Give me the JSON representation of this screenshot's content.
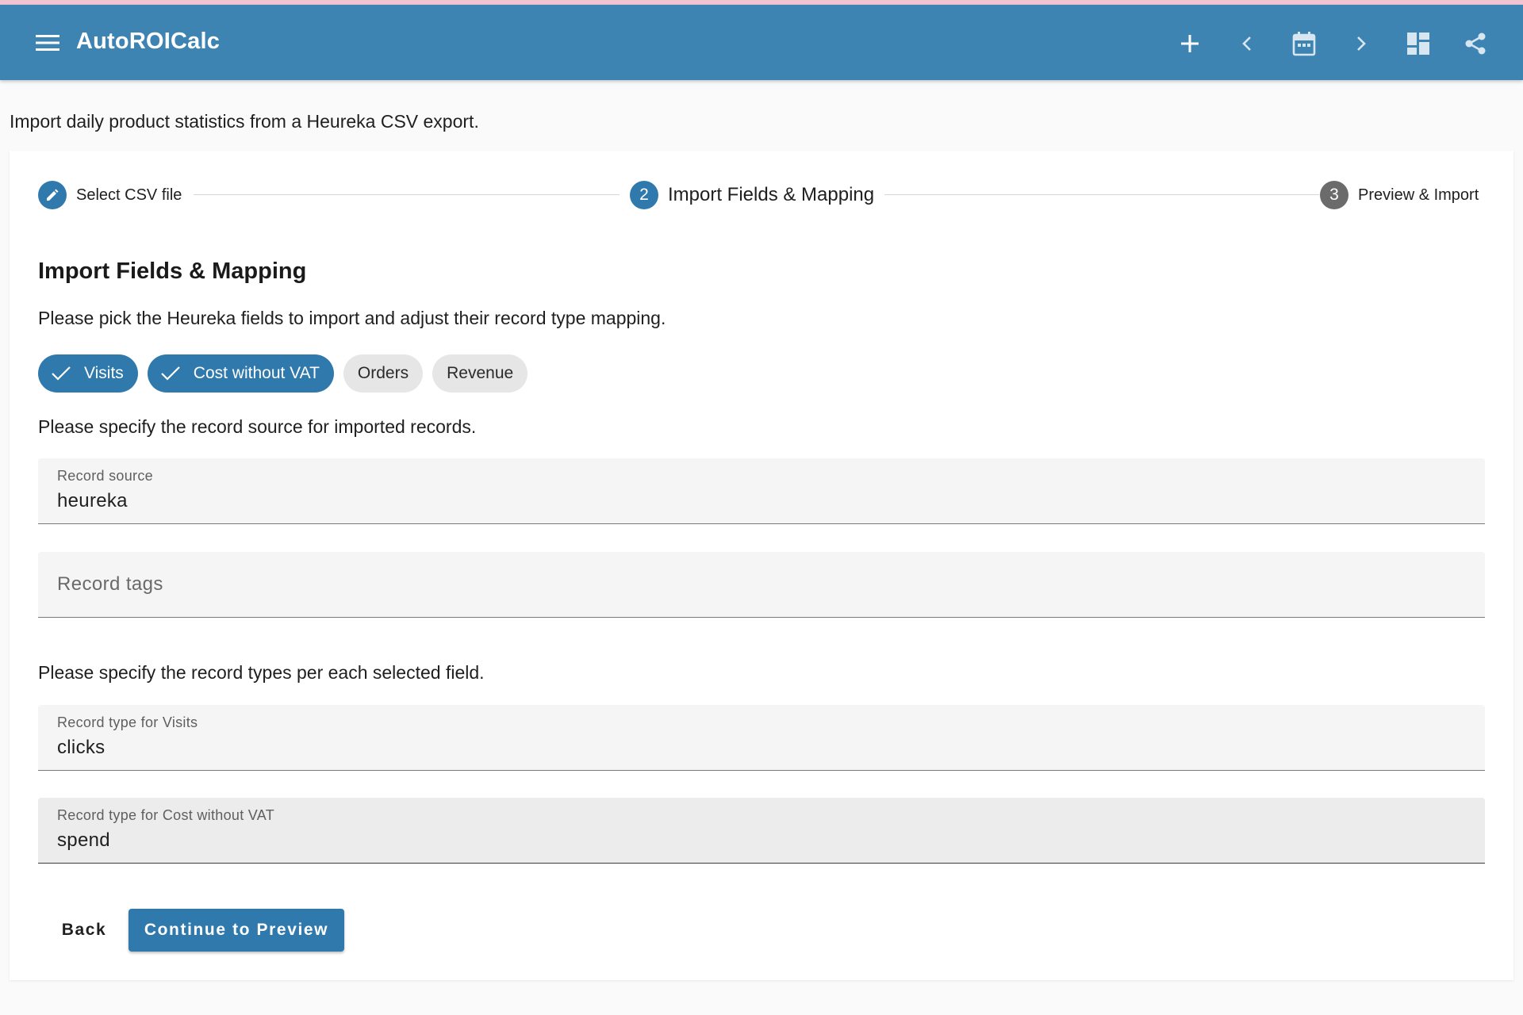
{
  "app": {
    "title": "AutoROICalc"
  },
  "appbar": {
    "icons": [
      "menu-icon",
      "plus-icon",
      "chevron-left-icon",
      "calendar-icon",
      "chevron-right-icon",
      "dashboard-icon",
      "share-icon"
    ]
  },
  "intro": "Import daily product statistics from a Heureka CSV export.",
  "stepper": {
    "steps": [
      {
        "label": "Select CSV file",
        "state": "done",
        "icon": "pencil-icon"
      },
      {
        "number": "2",
        "label": "Import Fields & Mapping",
        "state": "active"
      },
      {
        "number": "3",
        "label": "Preview & Import",
        "state": "todo"
      }
    ]
  },
  "section": {
    "title": "Import Fields & Mapping",
    "fields_instruction": "Please pick the Heureka fields to import and adjust their record type mapping.",
    "source_instruction": "Please specify the record source for imported records.",
    "types_instruction": "Please specify the record types per each selected field."
  },
  "chips": [
    {
      "label": "Visits",
      "selected": true
    },
    {
      "label": "Cost without VAT",
      "selected": true
    },
    {
      "label": "Orders",
      "selected": false
    },
    {
      "label": "Revenue",
      "selected": false
    }
  ],
  "fields": {
    "record_source": {
      "label": "Record source",
      "value": "heureka"
    },
    "record_tags": {
      "placeholder": "Record tags",
      "value": ""
    },
    "type_visits": {
      "label": "Record type for Visits",
      "value": "clicks"
    },
    "type_cost": {
      "label": "Record type for Cost without VAT",
      "value": "spend"
    }
  },
  "buttons": {
    "back": "Back",
    "continue": "Continue to Preview"
  },
  "colors": {
    "primary": "#3e84b3",
    "accent": "#2f79ad",
    "chip_unselected": "#e6e6e6",
    "step_inactive": "#6b6b6b"
  }
}
